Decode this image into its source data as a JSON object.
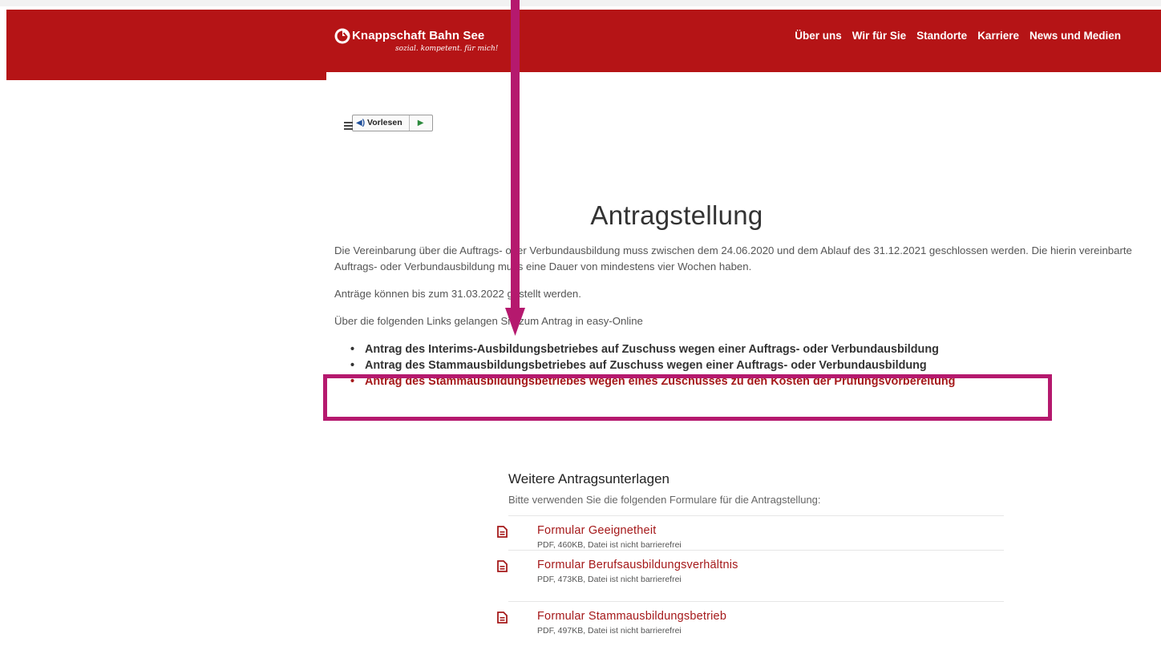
{
  "header": {
    "logo_name": "Knappschaft Bahn See",
    "logo_tagline": "sozial. kompetent. für mich!",
    "nav": [
      "Über uns",
      "Wir für Sie",
      "Standorte",
      "Karriere",
      "News und Medien"
    ],
    "brand_color": "#b51416"
  },
  "readspeaker": {
    "listen_label": "Vorlesen",
    "speaker_icon": "speaker-icon",
    "play_icon": "play-icon",
    "menu_icon": "menu-icon"
  },
  "main": {
    "title": "Antragstellung",
    "paragraphs": [
      "Die Vereinbarung über die Auftrags- oder Verbundausbildung muss zwischen dem 24.06.2020 und dem Ablauf des 31.12.2021 geschlossen werden. Die hierin vereinbarte Auftrags- oder Verbundausbildung muss eine Dauer von mindestens vier Wochen haben.",
      "Anträge können bis zum 31.03.2022 gestellt werden.",
      "Über die folgenden Links gelangen Sie zum Antrag in easy-Online"
    ],
    "links": [
      "Antrag des Interims-Ausbildungsbetriebes auf Zuschuss wegen einer Auftrags- oder Verbundausbildung",
      "Antrag des Stammausbildungsbetriebes auf Zuschuss wegen einer Auftrags- oder Verbundausbildung",
      "Antrag des Stammausbildungsbetriebes wegen eines Zuschusses zu den Kosten der Prüfungsvorbereitung"
    ]
  },
  "further": {
    "heading": "Weitere Antragsunterlagen",
    "subtext": "Bitte verwenden Sie die folgenden Formulare für die Antragstellung:",
    "documents": [
      {
        "title": "Formular Geeignetheit",
        "meta": "PDF, 460KB, Datei ist nicht barrierefrei"
      },
      {
        "title": "Formular Berufsausbildungsverhältnis",
        "meta": "PDF, 473KB, Datei ist nicht barrierefrei"
      },
      {
        "title": "Formular Stammausbildungsbetrieb",
        "meta": "PDF, 497KB, Datei ist nicht barrierefrei"
      }
    ],
    "doc_icon": "document-icon"
  },
  "annotation": {
    "color": "#b5196e",
    "arrow_icon": "arrow-down-icon"
  }
}
